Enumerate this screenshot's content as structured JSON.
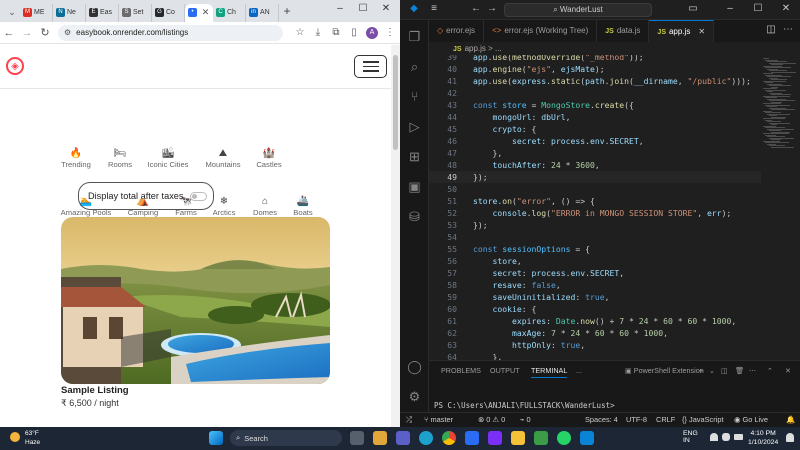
{
  "browser": {
    "tabs": [
      {
        "label": "ME",
        "color": "#d93025",
        "badge": "M"
      },
      {
        "label": "Ne",
        "color": "#0b6e99",
        "badge": "N"
      },
      {
        "label": "Eas",
        "color": "#333333",
        "badge": "E"
      },
      {
        "label": "Set",
        "color": "#6b6b6b",
        "badge": "S"
      },
      {
        "label": "Co",
        "color": "#24292f",
        "badge": "G"
      },
      {
        "label": "",
        "color": "#2a6df4",
        "badge": "•",
        "active": true
      },
      {
        "label": "Ch",
        "color": "#10a37f",
        "badge": "C"
      },
      {
        "label": "AN",
        "color": "#0a66c2",
        "badge": "in"
      }
    ],
    "url": "easybook.onrender.com/listings"
  },
  "site": {
    "filters": [
      {
        "label": "Trending",
        "icon": "fire-icon",
        "glyph": "🔥"
      },
      {
        "label": "Rooms",
        "icon": "bed-icon",
        "glyph": "🛏"
      },
      {
        "label": "Iconic Cities",
        "icon": "city-icon",
        "glyph": "🏙"
      },
      {
        "label": "Mountains",
        "icon": "mountain-icon",
        "glyph": "⛰"
      },
      {
        "label": "Castles",
        "icon": "castle-icon",
        "glyph": "🏰"
      },
      {
        "label": "Amazing Pools",
        "icon": "pool-icon",
        "glyph": "🏊"
      },
      {
        "label": "Camping",
        "icon": "tent-icon",
        "glyph": "⛺"
      },
      {
        "label": "Farms",
        "icon": "cow-icon",
        "glyph": "🐄"
      },
      {
        "label": "Arctics",
        "icon": "snowflake-icon",
        "glyph": "❄"
      },
      {
        "label": "Domes",
        "icon": "igloo-icon",
        "glyph": "⌂"
      },
      {
        "label": "Boats",
        "icon": "ship-icon",
        "glyph": "🚢"
      }
    ],
    "tax_toggle_label": "Display total after taxes",
    "listing": {
      "title": "Sample Listing",
      "price": "₹ 6,500 / night"
    }
  },
  "vscode": {
    "search_label": "WanderLust",
    "tabs": [
      {
        "label": "error.ejs",
        "kind": "ejs"
      },
      {
        "label": "error.ejs (Working Tree)",
        "kind": "diff"
      },
      {
        "label": "data.js",
        "kind": "js"
      },
      {
        "label": "app.js",
        "kind": "js",
        "active": true
      }
    ],
    "breadcrumb": "app.js > ...",
    "current_line": 49,
    "code_lines": [
      {
        "n": 39,
        "text": "app.use(methodOverride(\"_method\"));"
      },
      {
        "n": 40,
        "text": "app.engine(\"ejs\", ejsMate);"
      },
      {
        "n": 41,
        "text": "app.use(express.static(path.join(__dirname, \"/public\")));"
      },
      {
        "n": 42,
        "text": ""
      },
      {
        "n": 43,
        "text": "const store = MongoStore.create({"
      },
      {
        "n": 44,
        "text": "    mongoUrl: dbUrl,"
      },
      {
        "n": 45,
        "text": "    crypto: {"
      },
      {
        "n": 46,
        "text": "        secret: process.env.SECRET,"
      },
      {
        "n": 47,
        "text": "    },"
      },
      {
        "n": 48,
        "text": "    touchAfter: 24 * 3600,"
      },
      {
        "n": 49,
        "text": "});"
      },
      {
        "n": 50,
        "text": ""
      },
      {
        "n": 51,
        "text": "store.on(\"error\", () => {"
      },
      {
        "n": 52,
        "text": "    console.log(\"ERROR in MONGO SESSION STORE\", err);"
      },
      {
        "n": 53,
        "text": "});"
      },
      {
        "n": 54,
        "text": ""
      },
      {
        "n": 55,
        "text": "const sessionOptions = {"
      },
      {
        "n": 56,
        "text": "    store,"
      },
      {
        "n": 57,
        "text": "    secret: process.env.SECRET,"
      },
      {
        "n": 58,
        "text": "    resave: false,"
      },
      {
        "n": 59,
        "text": "    saveUninitialized: true,"
      },
      {
        "n": 60,
        "text": "    cookie: {"
      },
      {
        "n": 61,
        "text": "        expires: Date.now() + 7 * 24 * 60 * 60 * 1000,"
      },
      {
        "n": 62,
        "text": "        maxAge: 7 * 24 * 60 * 60 * 1000,"
      },
      {
        "n": 63,
        "text": "        httpOnly: true,"
      },
      {
        "n": 64,
        "text": "    },"
      }
    ],
    "panel_tabs": [
      "PROBLEMS",
      "OUTPUT",
      "TERMINAL",
      "..."
    ],
    "panel_active": "TERMINAL",
    "terminal_profile": "PowerShell Extension",
    "terminal_prompt": "PS C:\\Users\\ANJALI\\FULLSTACK\\WanderLust>",
    "status": {
      "branch": "master",
      "problems": "⊗ 0 ⚠ 0",
      "ports": "0",
      "spaces": "Spaces: 4",
      "encoding": "UTF-8",
      "eol": "CRLF",
      "language": "JavaScript",
      "golive": "Go Live"
    }
  },
  "taskbar": {
    "weather_temp": "63°F",
    "weather_desc": "Haze",
    "search_label": "Search",
    "lang": "ENG",
    "region": "IN",
    "time": "4:10 PM",
    "date": "1/10/2024"
  }
}
